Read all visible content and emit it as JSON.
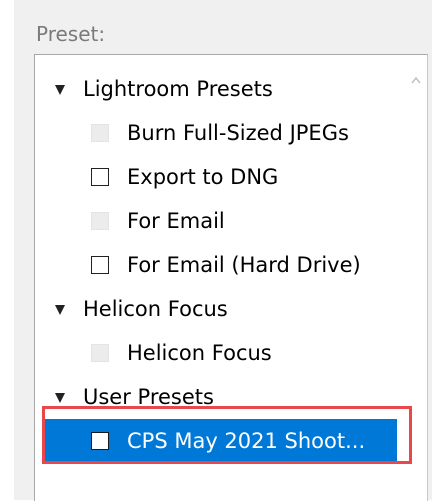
{
  "panel": {
    "label": "Preset:"
  },
  "tree": {
    "groups": [
      {
        "label": "Lightroom Presets",
        "items": [
          {
            "label": "Burn Full-Sized JPEGs",
            "enabled": false
          },
          {
            "label": "Export to DNG",
            "enabled": true
          },
          {
            "label": "For Email",
            "enabled": false
          },
          {
            "label": "For Email (Hard Drive)",
            "enabled": true
          }
        ]
      },
      {
        "label": "Helicon Focus",
        "items": [
          {
            "label": "Helicon Focus",
            "enabled": false
          }
        ]
      },
      {
        "label": "User Presets",
        "items": [
          {
            "label": "CPS May 2021 Shoot...",
            "enabled": true,
            "selected": true
          }
        ]
      }
    ]
  },
  "icons": {
    "expand": "triangle-down-icon",
    "scroll_up": "chevron-up-icon"
  },
  "colors": {
    "selection": "#0078d7",
    "annotation": "#e8474c",
    "panel_bg": "#f0f0f0"
  }
}
